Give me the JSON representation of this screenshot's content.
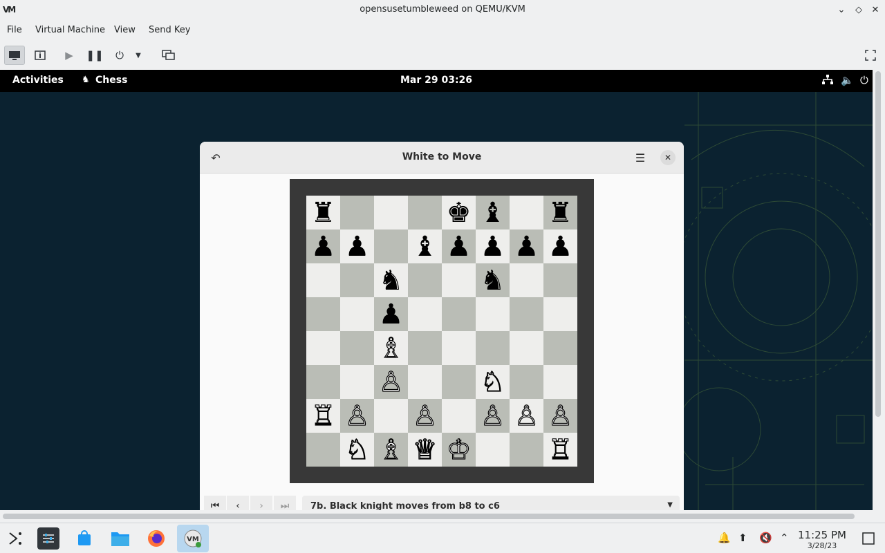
{
  "host": {
    "window_title": "opensusetumbleweed on QEMU/KVM",
    "logo_text": "VM",
    "menu": [
      "File",
      "Virtual Machine",
      "View",
      "Send Key"
    ]
  },
  "gnome": {
    "activities": "Activities",
    "app_name": "Chess",
    "clock": "Mar 29  03:26"
  },
  "chess": {
    "title": "White to Move",
    "board": [
      [
        "♜",
        "",
        "",
        "",
        "♚",
        "♝",
        "",
        "♜"
      ],
      [
        "♟",
        "♟",
        "",
        "♝",
        "♟",
        "♟",
        "♟",
        "♟"
      ],
      [
        "",
        "",
        "♞",
        "",
        "",
        "♞",
        "",
        ""
      ],
      [
        "",
        "",
        "♟",
        "",
        "",
        "",
        "",
        ""
      ],
      [
        "",
        "",
        "♗",
        "",
        "",
        "",
        "",
        ""
      ],
      [
        "",
        "",
        "♙",
        "",
        "",
        "♘",
        "",
        ""
      ],
      [
        "♖",
        "♙",
        "",
        "♙",
        "",
        "♙",
        "♙",
        "♙"
      ],
      [
        "",
        "♘",
        "♗",
        "♕",
        "♔",
        "",
        "",
        "♖"
      ]
    ],
    "history_text": "7b. Black knight moves from b8 to c6"
  },
  "taskbar": {
    "time": "11:25 PM",
    "date": "3/28/23"
  }
}
